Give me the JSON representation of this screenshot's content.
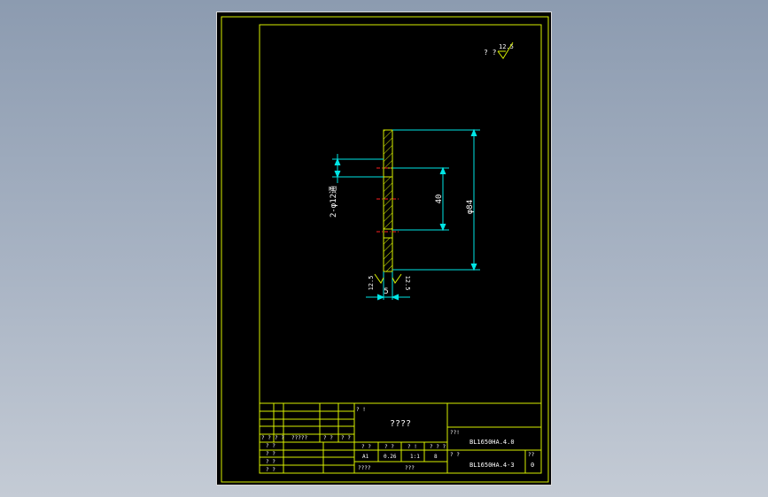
{
  "colors": {
    "background": "#000000",
    "frame": "#e8e8e8",
    "border": "#d8f000",
    "part": "#d8f000",
    "dimension": "#00e6e6",
    "centerline": "#ff2020",
    "text": "#ffffff"
  },
  "surface_finish": {
    "general_label": "? ?",
    "general_value": "12.5",
    "left_face_value": "12.5",
    "right_face_value": "12.5"
  },
  "dimensions": {
    "holes": "2-φ12通",
    "hole_spacing": "40",
    "outer_diameter": "φ84",
    "thickness": "5"
  },
  "title_block": {
    "top_left_label": "? !",
    "part_name": "????",
    "drawing_label": "??!",
    "drawing_number": "BL1650HA.4.0",
    "code_label": "? ?",
    "code_value": "BL1650HA.4-3",
    "sheet_label": "??",
    "sheet_value": "0",
    "rev_row": [
      "? ?",
      "? ?",
      "?????",
      "? ?",
      "? ?"
    ],
    "sign_rows": [
      "? ?",
      "? ?",
      "? ?",
      "? ?"
    ],
    "spec_headers": [
      "? ?",
      "? ?",
      "? !",
      "? ? ?"
    ],
    "spec_values": [
      "A1",
      "0.26",
      "1:1",
      "8"
    ],
    "material_label": "????",
    "scale_label": "???"
  }
}
